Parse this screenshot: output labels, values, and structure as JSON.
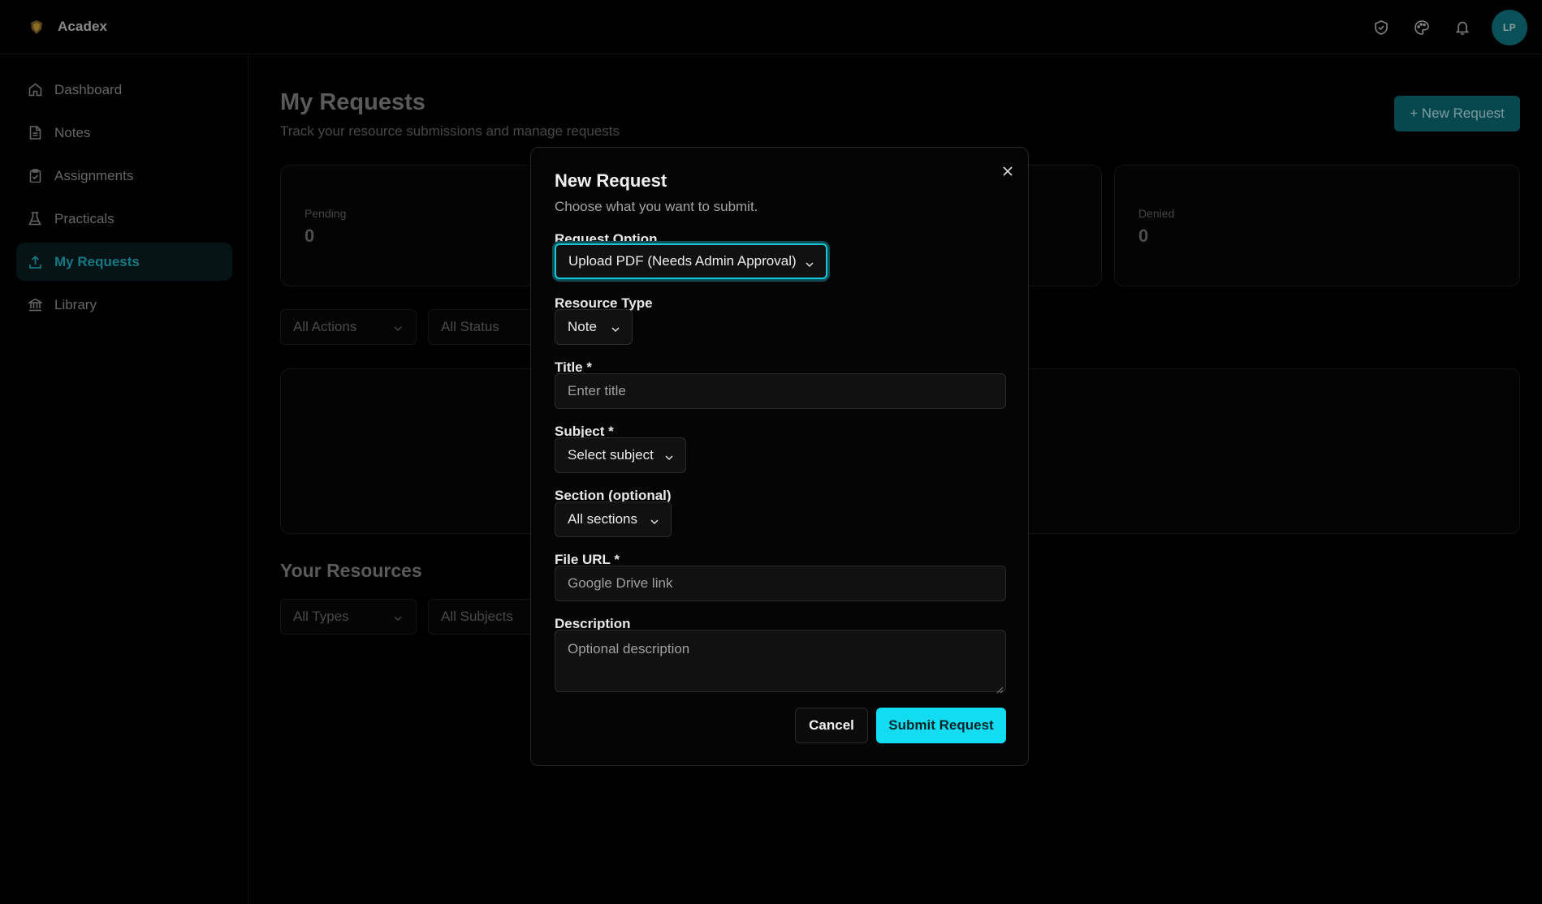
{
  "app": {
    "name": "Acadex",
    "user_initials": "LP"
  },
  "topbar": {
    "icons": [
      "shield-check-icon",
      "palette-icon",
      "bell-icon"
    ]
  },
  "sidebar": {
    "items": [
      {
        "label": "Dashboard",
        "icon": "home-icon",
        "active": false
      },
      {
        "label": "Notes",
        "icon": "file-icon",
        "active": false
      },
      {
        "label": "Assignments",
        "icon": "clipboard-check-icon",
        "active": false
      },
      {
        "label": "Practicals",
        "icon": "flask-icon",
        "active": false
      },
      {
        "label": "My Requests",
        "icon": "upload-icon",
        "active": true
      },
      {
        "label": "Library",
        "icon": "library-icon",
        "active": false
      }
    ]
  },
  "main": {
    "title": "My Requests",
    "subtitle": "Track your resource submissions and manage requests",
    "new_request_label": "+ New Request",
    "stats": [
      {
        "label": "Pending",
        "value": "0"
      },
      {
        "label": "Denied",
        "value": "0"
      }
    ],
    "filters": {
      "actions": "All Actions",
      "status": "All Status"
    },
    "resources_title": "Your Resources",
    "resource_filters": {
      "types": "All Types",
      "subjects": "All Subjects"
    }
  },
  "modal": {
    "title": "New Request",
    "subtitle": "Choose what you want to submit.",
    "request_option": {
      "label": "Request Option",
      "value": "Upload PDF (Needs Admin Approval)"
    },
    "resource_type": {
      "label": "Resource Type",
      "value": "Note"
    },
    "title_field": {
      "label": "Title *",
      "placeholder": "Enter title"
    },
    "subject": {
      "label": "Subject *",
      "value": "Select subject"
    },
    "section": {
      "label": "Section (optional)",
      "value": "All sections"
    },
    "file_url": {
      "label": "File URL *",
      "placeholder": "Google Drive link"
    },
    "description": {
      "label": "Description",
      "placeholder": "Optional description"
    },
    "cancel_label": "Cancel",
    "submit_label": "Submit Request"
  },
  "colors": {
    "accent": "#12dcf2",
    "accent_dark": "#0c6f7a",
    "background": "#000000"
  }
}
